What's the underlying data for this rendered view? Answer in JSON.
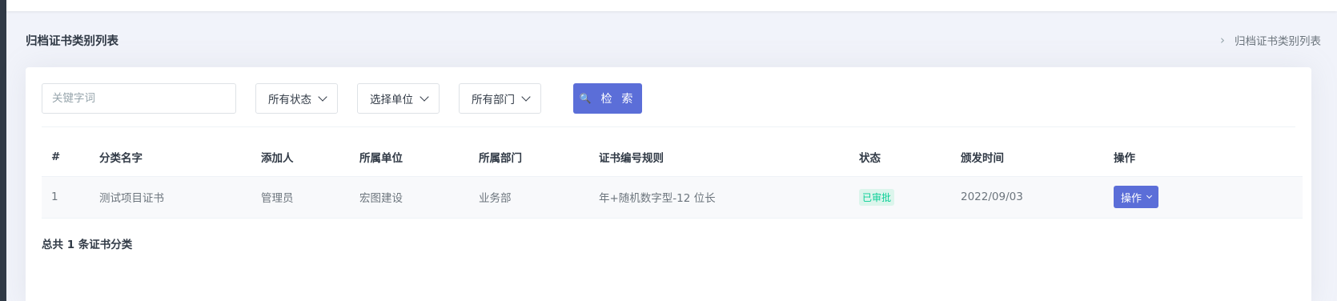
{
  "page": {
    "title": "归档证书类别列表",
    "breadcrumb": "归档证书类别列表"
  },
  "filters": {
    "keyword_placeholder": "关键字词",
    "status_label": "所有状态",
    "unit_label": "选择单位",
    "dept_label": "所有部门",
    "search_label": "检 索"
  },
  "table": {
    "headers": [
      "#",
      "分类名字",
      "添加人",
      "所属单位",
      "所属部门",
      "证书编号规则",
      "状态",
      "颁发时间",
      "操作"
    ],
    "rows": [
      {
        "index": "1",
        "name": "测试项目证书",
        "creator": "管理员",
        "unit": "宏图建设",
        "dept": "业务部",
        "rule": "年+随机数字型-12 位长",
        "status": "已审批",
        "date": "2022/09/03",
        "action": "操作"
      }
    ]
  },
  "footer": {
    "total": "总共 1 条证书分类"
  },
  "colors": {
    "primary": "#5b6ed8",
    "success": "#0acf97",
    "success_bg": "#dcf5ec"
  }
}
